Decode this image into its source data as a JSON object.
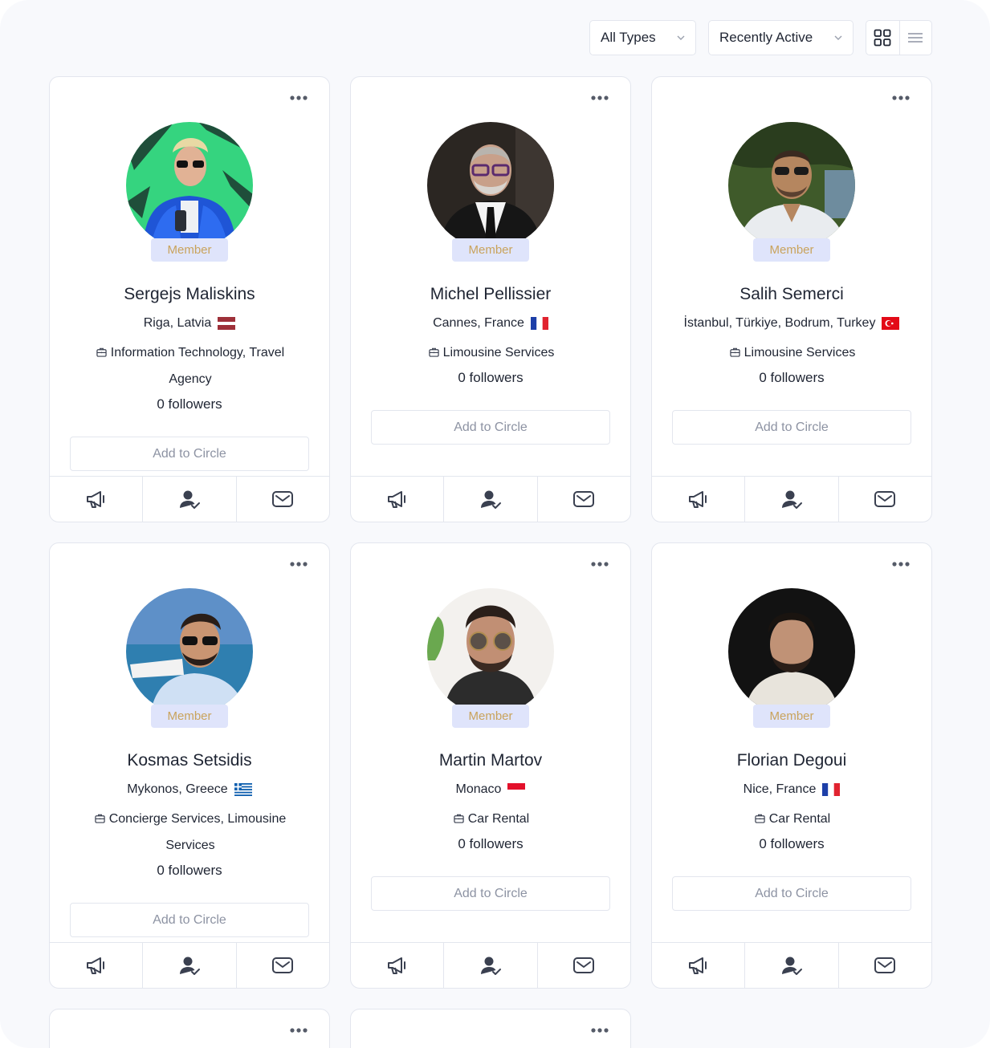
{
  "toolbar": {
    "type_filter": "All Types",
    "sort_filter": "Recently Active"
  },
  "colors": {
    "accent_text": "#c9a35c",
    "badge_bg": "#dfe4fb",
    "border": "#e3e6ee"
  },
  "cards": [
    {
      "name": "Sergejs Maliskins",
      "location": "Riga, Latvia",
      "flag": "latvia",
      "industry": "Information Technology, Travel Agency",
      "followers": "0 followers",
      "badge": "Member",
      "add_label": "Add to Circle"
    },
    {
      "name": "Michel Pellissier",
      "location": "Cannes, France",
      "flag": "france",
      "industry": "Limousine Services",
      "followers": "0 followers",
      "badge": "Member",
      "add_label": "Add to Circle"
    },
    {
      "name": "Salih Semerci",
      "location": "İstanbul, Türkiye, Bodrum, Turkey",
      "flag": "turkey",
      "industry": "Limousine Services",
      "followers": "0 followers",
      "badge": "Member",
      "add_label": "Add to Circle"
    },
    {
      "name": "Kosmas Setsidis",
      "location": "Mykonos, Greece",
      "flag": "greece",
      "industry": "Concierge Services, Limousine Services",
      "followers": "0 followers",
      "badge": "Member",
      "add_label": "Add to Circle"
    },
    {
      "name": "Martin Martov",
      "location": "Monaco",
      "flag": "monaco",
      "industry": "Car Rental",
      "followers": "0 followers",
      "badge": "Member",
      "add_label": "Add to Circle"
    },
    {
      "name": "Florian Degoui",
      "location": "Nice, France",
      "flag": "france",
      "industry": "Car Rental",
      "followers": "0 followers",
      "badge": "Member",
      "add_label": "Add to Circle"
    }
  ]
}
